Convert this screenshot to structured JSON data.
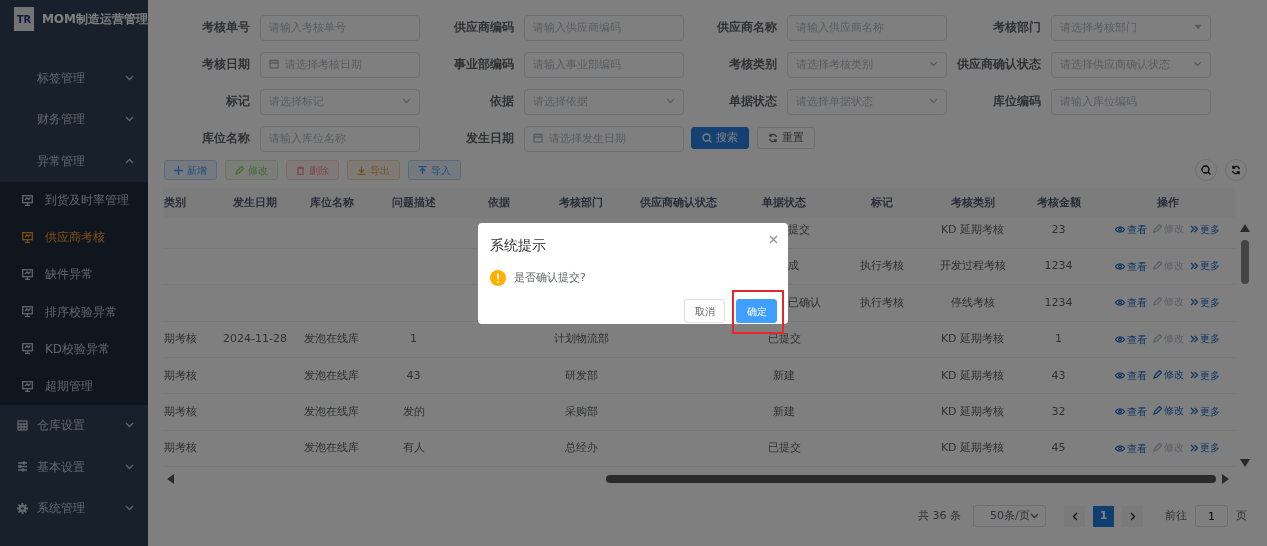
{
  "sidebar": {
    "logo": "TR",
    "title": "MOM制造运营管理",
    "items": [
      {
        "label": "标签管理",
        "expanded": false
      },
      {
        "label": "财务管理",
        "expanded": false
      },
      {
        "label": "异常管理",
        "expanded": true,
        "children": [
          {
            "label": "到货及时率管理",
            "selected": false
          },
          {
            "label": "供应商考核",
            "selected": true
          },
          {
            "label": "缺件异常",
            "selected": false
          },
          {
            "label": "排序校验异常",
            "selected": false
          },
          {
            "label": "KD校验异常",
            "selected": false
          },
          {
            "label": "超期管理",
            "selected": false
          }
        ]
      },
      {
        "label": "仓库设置",
        "expanded": false
      },
      {
        "label": "基本设置",
        "expanded": false
      },
      {
        "label": "系统管理",
        "expanded": false
      }
    ]
  },
  "filters": [
    {
      "label": "考核单号",
      "placeholder": "请输入考核单号",
      "kind": "text"
    },
    {
      "label": "供应商编码",
      "placeholder": "请输入供应商编码",
      "kind": "text"
    },
    {
      "label": "供应商名称",
      "placeholder": "请输入供应商名称",
      "kind": "text"
    },
    {
      "label": "考核部门",
      "placeholder": "请选择考核部门",
      "kind": "combo"
    },
    {
      "label": "考核日期",
      "placeholder": "请选择考核日期",
      "kind": "date"
    },
    {
      "label": "事业部编码",
      "placeholder": "请输入事业部编码",
      "kind": "text"
    },
    {
      "label": "考核类别",
      "placeholder": "请选择考核类别",
      "kind": "select"
    },
    {
      "label": "供应商确认状态",
      "placeholder": "请选择供应商确认状态",
      "kind": "select"
    },
    {
      "label": "标记",
      "placeholder": "请选择标记",
      "kind": "select"
    },
    {
      "label": "依据",
      "placeholder": "请选择依据",
      "kind": "select"
    },
    {
      "label": "单据状态",
      "placeholder": "请选择单据状态",
      "kind": "select"
    },
    {
      "label": "库位编码",
      "placeholder": "请输入库位编码",
      "kind": "text"
    },
    {
      "label": "库位名称",
      "placeholder": "请输入库位名称",
      "kind": "text"
    },
    {
      "label": "发生日期",
      "placeholder": "请选择发生日期",
      "kind": "date"
    }
  ],
  "search_buttons": [
    {
      "label": "搜索",
      "kind": "search"
    },
    {
      "label": "重置",
      "kind": "reset"
    }
  ],
  "toolbar": [
    {
      "label": "新增",
      "kind": "add",
      "disabled": false
    },
    {
      "label": "修改",
      "kind": "edit",
      "disabled": true
    },
    {
      "label": "删除",
      "kind": "delete",
      "disabled": true
    },
    {
      "label": "导出",
      "kind": "export",
      "disabled": false
    },
    {
      "label": "导入",
      "kind": "import",
      "disabled": false
    }
  ],
  "table": {
    "columns": [
      "类别",
      "发生日期",
      "库位名称",
      "问题描述",
      "依据",
      "考核部门",
      "供应商确认状态",
      "单据状态",
      "标记",
      "考核类别",
      "考核金额",
      "操作"
    ],
    "rows": [
      {
        "cells": [
          null,
          null,
          null,
          null,
          null,
          null,
          null,
          "提交",
          null,
          "KD 延期考核",
          "23"
        ],
        "actions": [
          {
            "label": "查看",
            "kind": "view",
            "disabled": false
          },
          {
            "label": "修改",
            "kind": "edit",
            "disabled": true
          },
          {
            "label": "更多",
            "kind": "more",
            "disabled": false
          }
        ]
      },
      {
        "cells": [
          null,
          null,
          null,
          null,
          null,
          null,
          null,
          "成",
          "执行考核",
          "开发过程考核",
          "1234"
        ],
        "actions": [
          {
            "label": "查看",
            "kind": "view",
            "disabled": false
          },
          {
            "label": "修改",
            "kind": "edit",
            "disabled": true
          },
          {
            "label": "更多",
            "kind": "more",
            "disabled": false
          }
        ]
      },
      {
        "cells": [
          null,
          null,
          null,
          null,
          null,
          null,
          null,
          "已确认",
          "执行考核",
          "停线考核",
          "1234"
        ],
        "actions": [
          {
            "label": "查看",
            "kind": "view",
            "disabled": false
          },
          {
            "label": "修改",
            "kind": "edit",
            "disabled": true
          },
          {
            "label": "更多",
            "kind": "more",
            "disabled": false
          }
        ]
      },
      {
        "cells": [
          "期考核",
          "2024-11-28",
          "发泡在线库",
          "1",
          null,
          "计划物流部",
          null,
          "已提交",
          null,
          "KD 延期考核",
          "1"
        ],
        "actions": [
          {
            "label": "查看",
            "kind": "view",
            "disabled": false
          },
          {
            "label": "修改",
            "kind": "edit",
            "disabled": true
          },
          {
            "label": "更多",
            "kind": "more",
            "disabled": false
          }
        ]
      },
      {
        "cells": [
          "期考核",
          null,
          "发泡在线库",
          "43",
          null,
          "研发部",
          null,
          "新建",
          null,
          "KD 延期考核",
          "43"
        ],
        "actions": [
          {
            "label": "查看",
            "kind": "view",
            "disabled": false
          },
          {
            "label": "修改",
            "kind": "edit",
            "disabled": false
          },
          {
            "label": "更多",
            "kind": "more",
            "disabled": false
          }
        ]
      },
      {
        "cells": [
          "期考核",
          null,
          "发泡在线库",
          "发的",
          null,
          "采购部",
          null,
          "新建",
          null,
          "KD 延期考核",
          "32"
        ],
        "actions": [
          {
            "label": "查看",
            "kind": "view",
            "disabled": false
          },
          {
            "label": "修改",
            "kind": "edit",
            "disabled": false
          },
          {
            "label": "更多",
            "kind": "more",
            "disabled": false
          }
        ]
      },
      {
        "cells": [
          "期考核",
          null,
          "发泡在线库",
          "有人",
          null,
          "总经办",
          null,
          "已提交",
          null,
          "KD 延期考核",
          "45"
        ],
        "actions": [
          {
            "label": "查看",
            "kind": "view",
            "disabled": false
          },
          {
            "label": "修改",
            "kind": "edit",
            "disabled": true
          },
          {
            "label": "更多",
            "kind": "more",
            "disabled": false
          }
        ]
      }
    ]
  },
  "pagination": {
    "total": "共 36 条",
    "page_size": "50条/页",
    "pages": [
      {
        "label": "1",
        "selected": true
      }
    ],
    "goto_label": "前往",
    "goto_value": "1",
    "goto_suffix": "页"
  },
  "dialog": {
    "title": "系统提示",
    "message": "是否确认提交?",
    "buttons": [
      {
        "label": "取消",
        "kind": "default",
        "highlighted": false
      },
      {
        "label": "确定",
        "kind": "primary",
        "highlighted": true
      }
    ]
  }
}
